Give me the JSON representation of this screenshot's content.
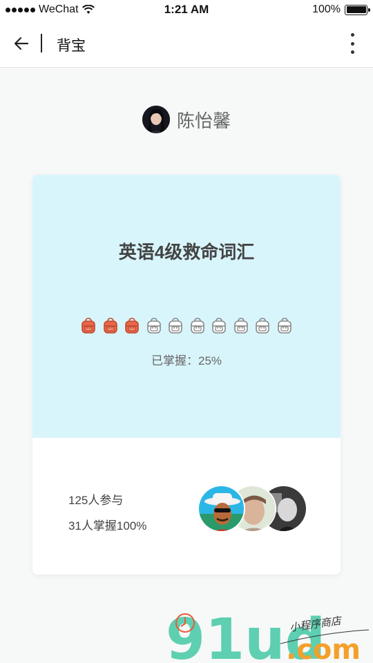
{
  "status_bar": {
    "carrier": "WeChat",
    "time": "1:21 AM",
    "battery": "100%"
  },
  "nav": {
    "title": "背宝"
  },
  "user": {
    "name": "陈怡馨"
  },
  "card": {
    "title": "英语4级救命词汇",
    "bags_total": 10,
    "bags_filled": 3,
    "mastery_text": "已掌握：25%",
    "participants_text": "125人参与",
    "mastered_text": "31人掌握100%",
    "participant_avatar_count": 3
  },
  "watermark": {
    "logo": "91ud",
    "suffix": ".com",
    "tagline": "小程序商店"
  },
  "colors": {
    "card_top_bg": "#d9f5fc",
    "bag_filled": "#e8664a",
    "bag_empty_stroke": "#888888"
  },
  "icons": [
    "back-arrow-icon",
    "more-vertical-icon",
    "wifi-icon",
    "backpack-icon"
  ]
}
